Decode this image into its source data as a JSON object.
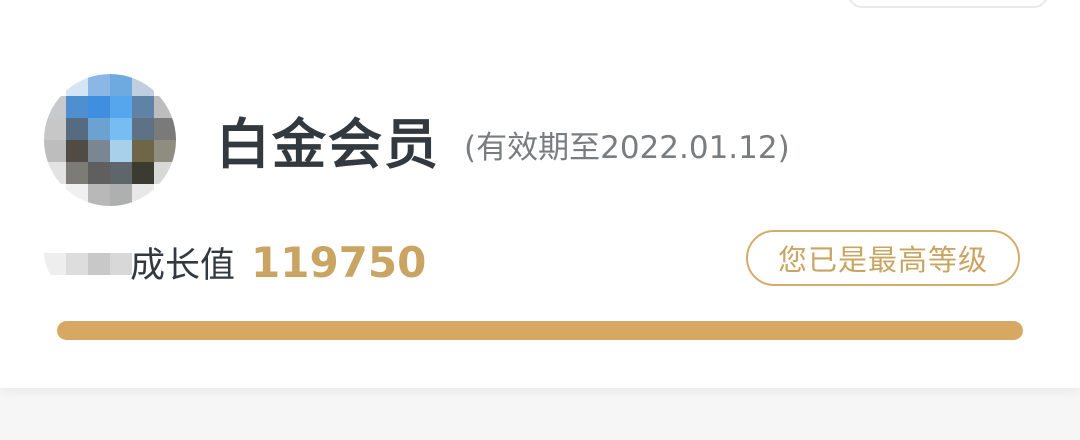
{
  "membership": {
    "level_name": "白金会员",
    "validity": "(有效期至2022.01.12)",
    "growth_label": "成长值",
    "growth_value": "119750",
    "level_button_label": "您已是最高等级",
    "progress": 1.0
  },
  "colors": {
    "accent_gold": "#c9a463",
    "progress_fill": "#d6a861",
    "title_text": "#333a3f",
    "secondary_text": "#7a7d80"
  },
  "icons": {
    "avatar": "pixelated-avatar"
  }
}
